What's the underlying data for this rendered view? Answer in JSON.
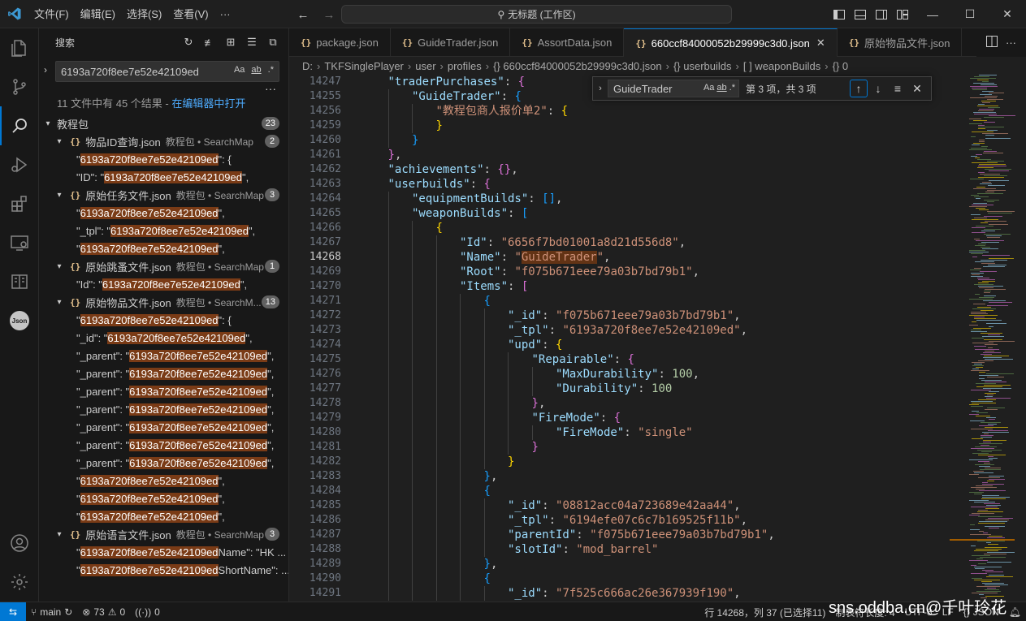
{
  "menu": [
    "文件(F)",
    "编辑(E)",
    "选择(S)",
    "查看(V)",
    "···"
  ],
  "command_center": "无标题 (工作区)",
  "sidebar": {
    "title": "搜索",
    "search_value": "6193a720f8ee7e52e42109ed",
    "opt_case": "Aa",
    "opt_word": "ab",
    "opt_regex": ".*",
    "summary": "11 文件中有 45 个结果 - ",
    "summary_link": "在编辑器中打开",
    "folder": {
      "name": "教程包",
      "count": "23"
    },
    "files": [
      {
        "name": "物品ID查询.json",
        "path": "教程包 • SearchMap",
        "count": "2",
        "matches": [
          [
            "\"",
            "6193a720f8ee7e52e42109ed",
            "\": {"
          ],
          [
            "\"ID\": \"",
            "6193a720f8ee7e52e42109ed",
            "\","
          ]
        ]
      },
      {
        "name": "原始任务文件.json",
        "path": "教程包 • SearchMap",
        "count": "3",
        "matches": [
          [
            "\"",
            "6193a720f8ee7e52e42109ed",
            "\","
          ],
          [
            "\"_tpl\": \"",
            "6193a720f8ee7e52e42109ed",
            "\","
          ],
          [
            "\"",
            "6193a720f8ee7e52e42109ed",
            "\","
          ]
        ]
      },
      {
        "name": "原始跳蚤文件.json",
        "path": "教程包 • SearchMap",
        "count": "1",
        "matches": [
          [
            "\"Id\": \"",
            "6193a720f8ee7e52e42109ed",
            "\","
          ]
        ]
      },
      {
        "name": "原始物品文件.json",
        "path": "教程包 • SearchM...",
        "count": "13",
        "matches": [
          [
            "\"",
            "6193a720f8ee7e52e42109ed",
            "\": {"
          ],
          [
            "\"_id\": \"",
            "6193a720f8ee7e52e42109ed",
            "\","
          ],
          [
            "\"_parent\": \"",
            "6193a720f8ee7e52e42109ed",
            "\","
          ],
          [
            "\"_parent\": \"",
            "6193a720f8ee7e52e42109ed",
            "\","
          ],
          [
            "\"_parent\": \"",
            "6193a720f8ee7e52e42109ed",
            "\","
          ],
          [
            "\"_parent\": \"",
            "6193a720f8ee7e52e42109ed",
            "\","
          ],
          [
            "\"_parent\": \"",
            "6193a720f8ee7e52e42109ed",
            "\","
          ],
          [
            "\"_parent\": \"",
            "6193a720f8ee7e52e42109ed",
            "\","
          ],
          [
            "\"_parent\": \"",
            "6193a720f8ee7e52e42109ed",
            "\","
          ],
          [
            "\"",
            "6193a720f8ee7e52e42109ed",
            "\","
          ],
          [
            "\"",
            "6193a720f8ee7e52e42109ed",
            "\","
          ],
          [
            "\"",
            "6193a720f8ee7e52e42109ed",
            "\","
          ]
        ]
      },
      {
        "name": "原始语言文件.json",
        "path": "教程包 • SearchMap",
        "count": "3",
        "matches": [
          [
            "\"",
            "6193a720f8ee7e52e42109ed",
            " Name\": \"HK ..."
          ],
          [
            "\"",
            "6193a720f8ee7e52e42109ed",
            " ShortName\": ..."
          ]
        ]
      }
    ]
  },
  "tabs": [
    {
      "label": "package.json",
      "active": false
    },
    {
      "label": "GuideTrader.json",
      "active": false
    },
    {
      "label": "AssortData.json",
      "active": false
    },
    {
      "label": "660ccf84000052b29999c3d0.json",
      "active": true
    },
    {
      "label": "原始物品文件.json",
      "active": false
    }
  ],
  "breadcrumb": [
    "D:",
    "TKFSinglePlayer",
    "user",
    "profiles",
    "{} 660ccf84000052b29999c3d0.json",
    "{} userbuilds",
    "[ ] weaponBuilds",
    "{} 0"
  ],
  "find": {
    "value": "GuideTrader",
    "count": "第 3 项，共 3 项"
  },
  "code_lines": [
    {
      "n": "14247",
      "i": 1,
      "t": [
        [
          "k",
          "\"traderPurchases\""
        ],
        [
          "x",
          ": "
        ],
        [
          "p2",
          "{"
        ]
      ]
    },
    {
      "n": "14255",
      "i": 2,
      "t": [
        [
          "k",
          "\"GuideTrader\""
        ],
        [
          "x",
          ": "
        ],
        [
          "p3",
          "{"
        ]
      ]
    },
    {
      "n": "14256",
      "i": 3,
      "t": [
        [
          "s",
          "\"教程包商人报价单2\""
        ],
        [
          "x",
          ": "
        ],
        [
          "p1",
          "{"
        ]
      ]
    },
    {
      "n": "14259",
      "i": 3,
      "t": [
        [
          "p1",
          "}"
        ]
      ]
    },
    {
      "n": "14260",
      "i": 2,
      "t": [
        [
          "p3",
          "}"
        ]
      ]
    },
    {
      "n": "14261",
      "i": 1,
      "t": [
        [
          "p2",
          "}"
        ],
        [
          "x",
          ","
        ]
      ]
    },
    {
      "n": "14262",
      "i": 1,
      "t": [
        [
          "k",
          "\"achievements\""
        ],
        [
          "x",
          ": "
        ],
        [
          "p2",
          "{}"
        ],
        [
          "x",
          ","
        ]
      ]
    },
    {
      "n": "14263",
      "i": 1,
      "t": [
        [
          "k",
          "\"userbuilds\""
        ],
        [
          "x",
          ": "
        ],
        [
          "p2",
          "{"
        ]
      ]
    },
    {
      "n": "14264",
      "i": 2,
      "t": [
        [
          "k",
          "\"equipmentBuilds\""
        ],
        [
          "x",
          ": "
        ],
        [
          "p3",
          "[]"
        ],
        [
          "x",
          ","
        ]
      ]
    },
    {
      "n": "14265",
      "i": 2,
      "t": [
        [
          "k",
          "\"weaponBuilds\""
        ],
        [
          "x",
          ": "
        ],
        [
          "p3",
          "["
        ]
      ]
    },
    {
      "n": "14266",
      "i": 3,
      "t": [
        [
          "p1",
          "{"
        ]
      ]
    },
    {
      "n": "14267",
      "i": 4,
      "t": [
        [
          "k",
          "\"Id\""
        ],
        [
          "x",
          ": "
        ],
        [
          "s",
          "\"6656f7bd01001a8d21d556d8\""
        ],
        [
          "x",
          ","
        ]
      ]
    },
    {
      "n": "14268",
      "i": 4,
      "cur": true,
      "t": [
        [
          "k",
          "\"Name\""
        ],
        [
          "x",
          ": "
        ],
        [
          "s",
          "\""
        ],
        [
          "sh",
          "GuideTrader"
        ],
        [
          "s",
          "\""
        ],
        [
          "x",
          ","
        ]
      ]
    },
    {
      "n": "14269",
      "i": 4,
      "t": [
        [
          "k",
          "\"Root\""
        ],
        [
          "x",
          ": "
        ],
        [
          "s",
          "\"f075b671eee79a03b7bd79b1\""
        ],
        [
          "x",
          ","
        ]
      ]
    },
    {
      "n": "14270",
      "i": 4,
      "t": [
        [
          "k",
          "\"Items\""
        ],
        [
          "x",
          ": "
        ],
        [
          "p2",
          "["
        ]
      ]
    },
    {
      "n": "14271",
      "i": 5,
      "t": [
        [
          "p3",
          "{"
        ]
      ]
    },
    {
      "n": "14272",
      "i": 6,
      "t": [
        [
          "k",
          "\"_id\""
        ],
        [
          "x",
          ": "
        ],
        [
          "s",
          "\"f075b671eee79a03b7bd79b1\""
        ],
        [
          "x",
          ","
        ]
      ]
    },
    {
      "n": "14273",
      "i": 6,
      "t": [
        [
          "k",
          "\"_tpl\""
        ],
        [
          "x",
          ": "
        ],
        [
          "s",
          "\"6193a720f8ee7e52e42109ed\""
        ],
        [
          "x",
          ","
        ]
      ]
    },
    {
      "n": "14274",
      "i": 6,
      "t": [
        [
          "k",
          "\"upd\""
        ],
        [
          "x",
          ": "
        ],
        [
          "p1",
          "{"
        ]
      ]
    },
    {
      "n": "14275",
      "i": 7,
      "t": [
        [
          "k",
          "\"Repairable\""
        ],
        [
          "x",
          ": "
        ],
        [
          "p2",
          "{"
        ]
      ]
    },
    {
      "n": "14276",
      "i": 8,
      "t": [
        [
          "k",
          "\"MaxDurability\""
        ],
        [
          "x",
          ": "
        ],
        [
          "n",
          "100"
        ],
        [
          "x",
          ","
        ]
      ]
    },
    {
      "n": "14277",
      "i": 8,
      "t": [
        [
          "k",
          "\"Durability\""
        ],
        [
          "x",
          ": "
        ],
        [
          "n",
          "100"
        ]
      ]
    },
    {
      "n": "14278",
      "i": 7,
      "t": [
        [
          "p2",
          "}"
        ],
        [
          "x",
          ","
        ]
      ]
    },
    {
      "n": "14279",
      "i": 7,
      "t": [
        [
          "k",
          "\"FireMode\""
        ],
        [
          "x",
          ": "
        ],
        [
          "p2",
          "{"
        ]
      ]
    },
    {
      "n": "14280",
      "i": 8,
      "t": [
        [
          "k",
          "\"FireMode\""
        ],
        [
          "x",
          ": "
        ],
        [
          "s",
          "\"single\""
        ]
      ]
    },
    {
      "n": "14281",
      "i": 7,
      "t": [
        [
          "p2",
          "}"
        ]
      ]
    },
    {
      "n": "14282",
      "i": 6,
      "t": [
        [
          "p1",
          "}"
        ]
      ]
    },
    {
      "n": "14283",
      "i": 5,
      "t": [
        [
          "p3",
          "}"
        ],
        [
          "x",
          ","
        ]
      ]
    },
    {
      "n": "14284",
      "i": 5,
      "t": [
        [
          "p3",
          "{"
        ]
      ]
    },
    {
      "n": "14285",
      "i": 6,
      "t": [
        [
          "k",
          "\"_id\""
        ],
        [
          "x",
          ": "
        ],
        [
          "s",
          "\"08812acc04a723689e42aa44\""
        ],
        [
          "x",
          ","
        ]
      ]
    },
    {
      "n": "14286",
      "i": 6,
      "t": [
        [
          "k",
          "\"_tpl\""
        ],
        [
          "x",
          ": "
        ],
        [
          "s",
          "\"6194efe07c6c7b169525f11b\""
        ],
        [
          "x",
          ","
        ]
      ]
    },
    {
      "n": "14287",
      "i": 6,
      "t": [
        [
          "k",
          "\"parentId\""
        ],
        [
          "x",
          ": "
        ],
        [
          "s",
          "\"f075b671eee79a03b7bd79b1\""
        ],
        [
          "x",
          ","
        ]
      ]
    },
    {
      "n": "14288",
      "i": 6,
      "t": [
        [
          "k",
          "\"slotId\""
        ],
        [
          "x",
          ": "
        ],
        [
          "s",
          "\"mod_barrel\""
        ]
      ]
    },
    {
      "n": "14289",
      "i": 5,
      "t": [
        [
          "p3",
          "}"
        ],
        [
          "x",
          ","
        ]
      ]
    },
    {
      "n": "14290",
      "i": 5,
      "t": [
        [
          "p3",
          "{"
        ]
      ]
    },
    {
      "n": "14291",
      "i": 6,
      "t": [
        [
          "k",
          "\"_id\""
        ],
        [
          "x",
          ": "
        ],
        [
          "s",
          "\"7f525c666ac26e367939f190\""
        ],
        [
          "x",
          ","
        ]
      ]
    }
  ],
  "status": {
    "branch": "main",
    "errors": "73",
    "warnings": "0",
    "ports": "0",
    "position": "行 14268，列 37 (已选择11)",
    "tabsize": "制表符长度: 4",
    "encoding": "UTF-8",
    "eol": "LF",
    "lang": "JSON"
  },
  "watermark": "sns.oddba.cn@千叶玲花"
}
